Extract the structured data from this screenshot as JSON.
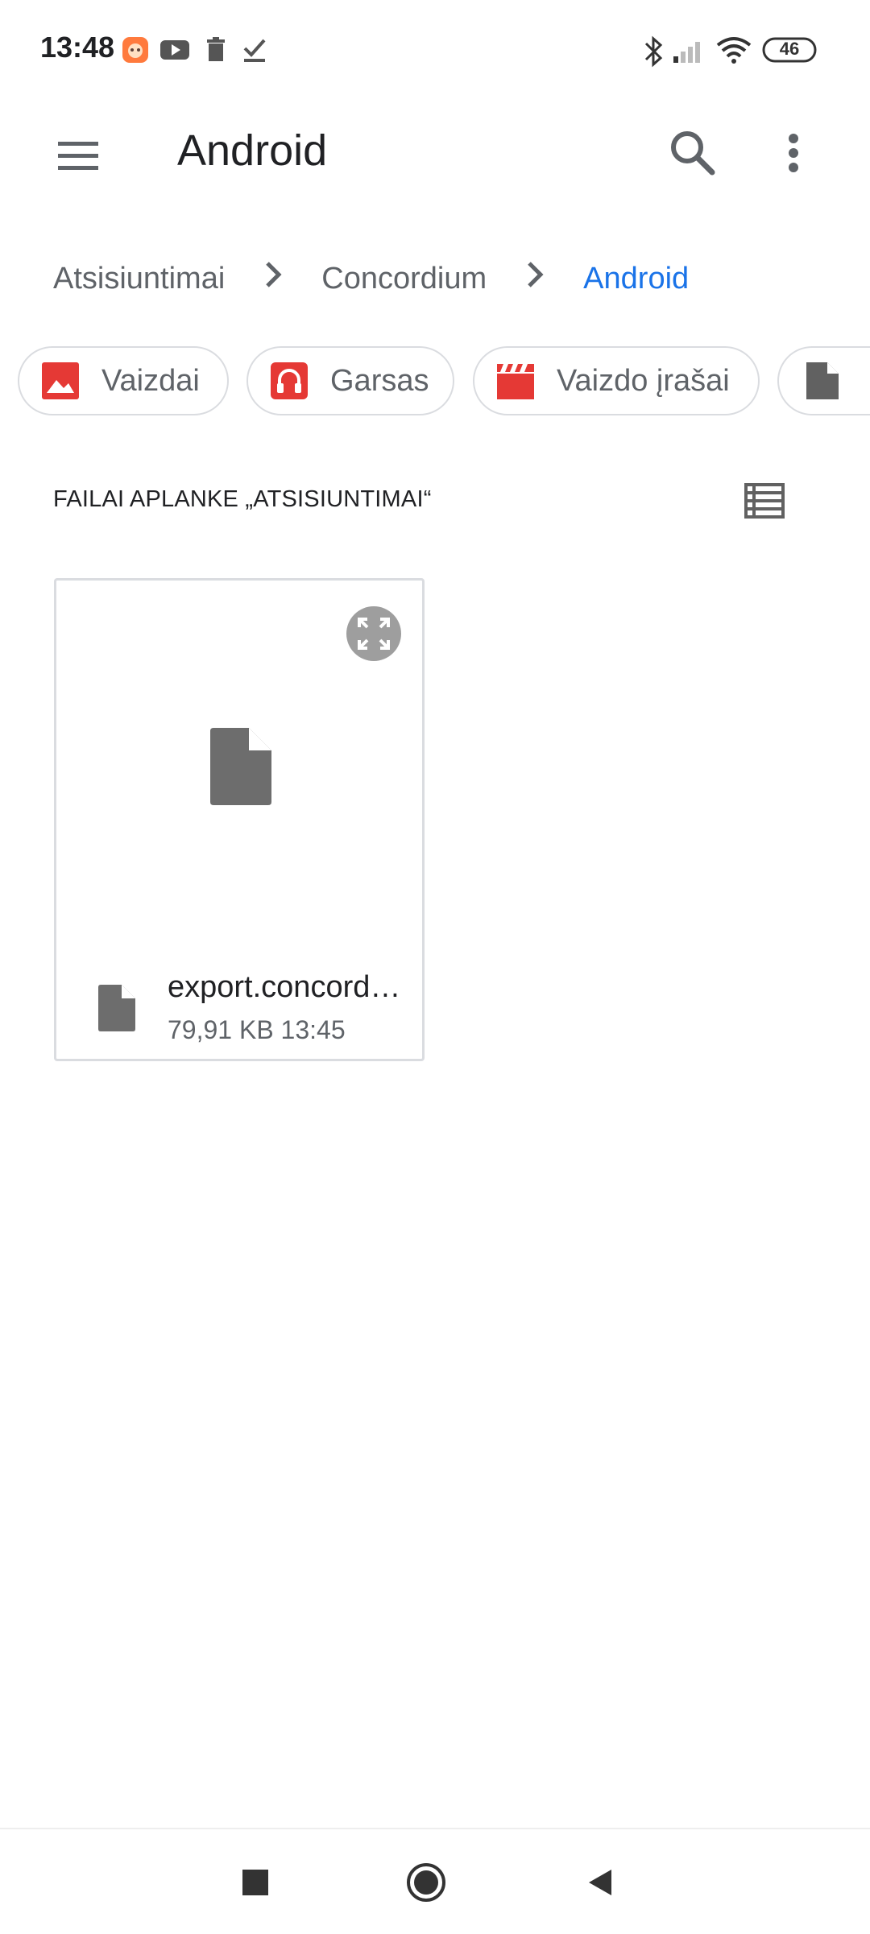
{
  "status_bar": {
    "time": "13:48",
    "notification_icons": [
      "mi-app-icon",
      "youtube-icon",
      "trash-icon",
      "check-icon"
    ],
    "right_icons": [
      "bluetooth-icon",
      "cell-signal-icon",
      "wifi-icon",
      "battery-icon"
    ],
    "battery": "46"
  },
  "app_bar": {
    "title": "Android",
    "menu_icon": "hamburger-menu-icon",
    "search_icon": "search-icon",
    "more_icon": "more-vert-icon"
  },
  "breadcrumb": {
    "items": [
      "Atsisiuntimai",
      "Concordium",
      "Android"
    ],
    "separator_icon": "chevron-right-icon"
  },
  "chips": [
    {
      "label": "Vaizdai",
      "icon": "image-icon",
      "icon_color": "#e53935"
    },
    {
      "label": "Garsas",
      "icon": "headphones-icon",
      "icon_color": "#e53935"
    },
    {
      "label": "Vaizdo įrašai",
      "icon": "movie-clapper-icon",
      "icon_color": "#e53935"
    },
    {
      "label": "",
      "icon": "document-icon",
      "icon_color": "#616161"
    }
  ],
  "section": {
    "header": "FAILAI APLANKE „ATSISIUNTIMAI“",
    "view_toggle_icon": "list-view-icon"
  },
  "files": [
    {
      "name": "export.concord…",
      "meta": "79,91 KB 13:45",
      "icon": "document-icon",
      "preview_icon": "document-icon",
      "expand_icon": "expand-icon"
    }
  ],
  "nav_bar": {
    "icons": [
      "recents-square-icon",
      "home-circle-icon",
      "back-triangle-icon"
    ]
  },
  "colors": {
    "accent": "#1a73e8",
    "chip_icon_red": "#e53935",
    "icon_gray": "#616161",
    "text_secondary": "#5f6368"
  }
}
